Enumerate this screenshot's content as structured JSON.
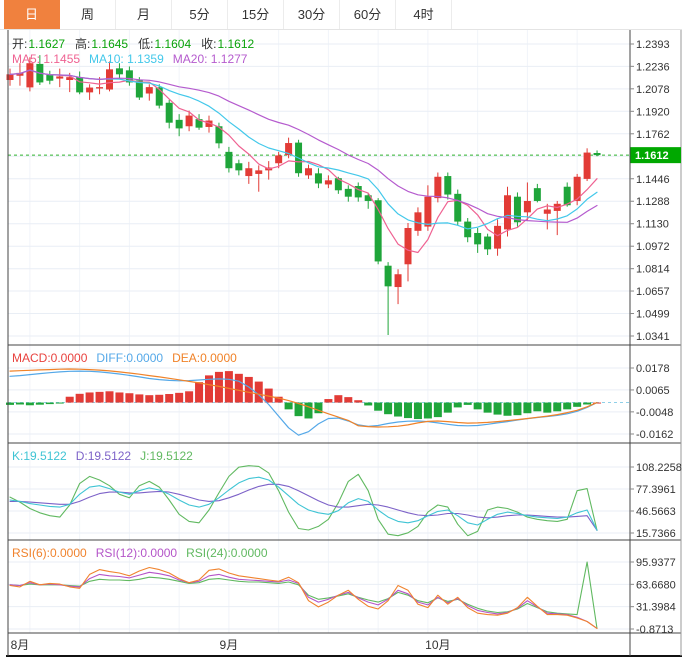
{
  "toolbar": {
    "tabs": [
      {
        "label": "日",
        "active": true
      },
      {
        "label": "周",
        "active": false
      },
      {
        "label": "月",
        "active": false
      },
      {
        "label": "5分",
        "active": false
      },
      {
        "label": "15分",
        "active": false
      },
      {
        "label": "30分",
        "active": false
      },
      {
        "label": "60分",
        "active": false
      },
      {
        "label": "4时",
        "active": false
      }
    ],
    "accent_color": "#f0813e"
  },
  "main_panel": {
    "ohlc_items": [
      {
        "key": "open",
        "label": "开:",
        "value": "1.1627"
      },
      {
        "key": "high",
        "label": "高:",
        "value": "1.1645"
      },
      {
        "key": "low",
        "label": "低:",
        "value": "1.1604"
      },
      {
        "key": "close",
        "label": "收:",
        "value": "1.1612"
      }
    ],
    "ma_legend": [
      {
        "key": "ma5",
        "text": "MA5: 1.1455",
        "color": "#ef6292"
      },
      {
        "key": "ma10",
        "text": "MA10: 1.1359",
        "color": "#43c8ea"
      },
      {
        "key": "ma20",
        "text": "MA20: 1.1277",
        "color": "#b55bce"
      }
    ]
  },
  "macd_panel": {
    "legend": [
      {
        "key": "macd",
        "text": "MACD:0.0000",
        "color": "#e8423e"
      },
      {
        "key": "diff",
        "text": "DIFF:0.0000",
        "color": "#54a8e8"
      },
      {
        "key": "dea",
        "text": "DEA:0.0000",
        "color": "#f08228"
      }
    ]
  },
  "kdj_panel": {
    "legend": [
      {
        "key": "k",
        "text": "K:19.5122",
        "color": "#3fc4d4"
      },
      {
        "key": "d",
        "text": "D:19.5122",
        "color": "#7d62c8"
      },
      {
        "key": "j",
        "text": "J:19.5122",
        "color": "#61b961"
      }
    ]
  },
  "rsi_panel": {
    "legend": [
      {
        "key": "rsi6",
        "text": "RSI(6):0.0000",
        "color": "#f0832e"
      },
      {
        "key": "rsi12",
        "text": "RSI(12):0.0000",
        "color": "#b455c8"
      },
      {
        "key": "rsi24",
        "text": "RSI(24):0.0000",
        "color": "#61b961"
      }
    ]
  },
  "chart_data": {
    "type": "candlestick",
    "timeframe": "daily",
    "x_axis": {
      "month_labels": [
        {
          "text": "8月",
          "index": 1
        },
        {
          "text": "9月",
          "index": 22
        },
        {
          "text": "10月",
          "index": 43
        }
      ]
    },
    "price_axis": {
      "ticks": [
        1.2393,
        1.2236,
        1.2078,
        1.192,
        1.1762,
        1.1446,
        1.1288,
        1.113,
        1.0972,
        1.0814,
        1.0657,
        1.0499,
        1.0341
      ],
      "hidden_tick": 1.1604,
      "current_price": 1.1612,
      "current_price_label": "1.1612"
    },
    "candles_format": [
      "open",
      "high",
      "low",
      "close"
    ],
    "candles": [
      [
        1.214,
        1.222,
        1.21,
        1.218
      ],
      [
        1.217,
        1.2258,
        1.21,
        1.219
      ],
      [
        1.2088,
        1.23,
        1.206,
        1.2258
      ],
      [
        1.2253,
        1.2315,
        1.2105,
        1.2123
      ],
      [
        1.2175,
        1.2205,
        1.211,
        1.2135
      ],
      [
        1.215,
        1.222,
        1.209,
        1.2165
      ],
      [
        1.214,
        1.219,
        1.2055,
        1.216
      ],
      [
        1.216,
        1.22,
        1.204,
        1.2053
      ],
      [
        1.2053,
        1.211,
        1.2,
        1.2087
      ],
      [
        1.209,
        1.216,
        1.204,
        1.209
      ],
      [
        1.2073,
        1.227,
        1.206,
        1.2215
      ],
      [
        1.2222,
        1.2258,
        1.215,
        1.218
      ],
      [
        1.2208,
        1.2235,
        1.21,
        1.2123
      ],
      [
        1.2137,
        1.216,
        1.2,
        1.2017
      ],
      [
        1.2045,
        1.211,
        1.1995,
        1.209
      ],
      [
        1.2088,
        1.211,
        1.194,
        1.196
      ],
      [
        1.198,
        1.2,
        1.18,
        1.184
      ],
      [
        1.186,
        1.19,
        1.1745,
        1.18
      ],
      [
        1.1815,
        1.1925,
        1.178,
        1.189
      ],
      [
        1.1865,
        1.19,
        1.179,
        1.1805
      ],
      [
        1.181,
        1.189,
        1.177,
        1.1855
      ],
      [
        1.1815,
        1.184,
        1.166,
        1.1695
      ],
      [
        1.1635,
        1.167,
        1.149,
        1.152
      ],
      [
        1.1555,
        1.158,
        1.147,
        1.1505
      ],
      [
        1.1465,
        1.1565,
        1.141,
        1.152
      ],
      [
        1.148,
        1.154,
        1.1355,
        1.1505
      ],
      [
        1.1505,
        1.157,
        1.144,
        1.1525
      ],
      [
        1.1555,
        1.1635,
        1.152,
        1.161
      ],
      [
        1.1612,
        1.1735,
        1.159,
        1.1697
      ],
      [
        1.17,
        1.172,
        1.146,
        1.1485
      ],
      [
        1.147,
        1.1545,
        1.1445,
        1.152
      ],
      [
        1.1484,
        1.152,
        1.138,
        1.1413
      ],
      [
        1.1406,
        1.147,
        1.138,
        1.1435
      ],
      [
        1.145,
        1.146,
        1.134,
        1.1365
      ],
      [
        1.1375,
        1.14,
        1.1285,
        1.132
      ],
      [
        1.1395,
        1.142,
        1.1285,
        1.1315
      ],
      [
        1.133,
        1.1345,
        1.1235,
        1.129
      ],
      [
        1.1295,
        1.131,
        1.0845,
        1.0865
      ],
      [
        1.0835,
        1.086,
        1.0348,
        1.069
      ],
      [
        1.0685,
        1.081,
        1.0565,
        1.0775
      ],
      [
        1.0845,
        1.1135,
        1.0725,
        1.11
      ],
      [
        1.108,
        1.1245,
        1.1045,
        1.121
      ],
      [
        1.111,
        1.14,
        1.108,
        1.132
      ],
      [
        1.131,
        1.149,
        1.128,
        1.146
      ],
      [
        1.1465,
        1.149,
        1.13,
        1.1335
      ],
      [
        1.134,
        1.137,
        1.112,
        1.1145
      ],
      [
        1.1145,
        1.117,
        1.1,
        1.1035
      ],
      [
        1.1065,
        1.11,
        1.0925,
        1.0985
      ],
      [
        1.104,
        1.106,
        1.091,
        1.095
      ],
      [
        1.0955,
        1.116,
        1.0905,
        1.1115
      ],
      [
        1.109,
        1.139,
        1.104,
        1.133
      ],
      [
        1.132,
        1.135,
        1.111,
        1.114
      ],
      [
        1.121,
        1.142,
        1.115,
        1.129
      ],
      [
        1.138,
        1.141,
        1.128,
        1.129
      ],
      [
        1.12,
        1.127,
        1.109,
        1.123
      ],
      [
        1.122,
        1.129,
        1.105,
        1.127
      ],
      [
        1.139,
        1.142,
        1.125,
        1.126
      ],
      [
        1.129,
        1.148,
        1.126,
        1.146
      ],
      [
        1.1445,
        1.166,
        1.143,
        1.163
      ],
      [
        1.1627,
        1.1645,
        1.1604,
        1.1612
      ]
    ],
    "ma_periods": [
      5,
      10,
      20
    ],
    "macd": {
      "ticks": [
        0.0178,
        0.0065,
        -0.0048,
        -0.0162
      ],
      "hist": [
        -0.0012,
        -0.001,
        -0.0014,
        -0.0011,
        -0.0008,
        -0.0005,
        0.003,
        0.0045,
        0.0052,
        0.0055,
        0.0058,
        0.0052,
        0.0048,
        0.0042,
        0.0038,
        0.004,
        0.0044,
        0.005,
        0.0058,
        0.0105,
        0.014,
        0.0158,
        0.0162,
        0.0148,
        0.0132,
        0.0108,
        0.0072,
        0.003,
        -0.0035,
        -0.007,
        -0.0082,
        -0.0055,
        0.0018,
        0.0038,
        0.0028,
        0.0012,
        -0.0015,
        -0.0042,
        -0.006,
        -0.0072,
        -0.008,
        -0.0085,
        -0.0082,
        -0.0075,
        -0.0052,
        -0.0025,
        -0.0012,
        -0.0035,
        -0.0052,
        -0.0062,
        -0.0068,
        -0.0065,
        -0.0055,
        -0.0045,
        -0.0052,
        -0.0045,
        -0.0035,
        -0.0022,
        -0.001,
        0.0
      ],
      "diff": [
        0.0135,
        0.0139,
        0.0144,
        0.0149,
        0.0154,
        0.0158,
        0.0161,
        0.0162,
        0.0161,
        0.0158,
        0.0153,
        0.0147,
        0.014,
        0.0132,
        0.0124,
        0.0118,
        0.0114,
        0.0112,
        0.0113,
        0.0116,
        0.012,
        0.0122,
        0.012,
        0.011,
        0.008,
        0.004,
        -0.001,
        -0.007,
        -0.013,
        -0.0168,
        -0.015,
        -0.011,
        -0.0082,
        -0.008,
        -0.0095,
        -0.0115,
        -0.0123,
        -0.0118,
        -0.0108,
        -0.01,
        -0.0096,
        -0.0095,
        -0.0098,
        -0.0105,
        -0.0112,
        -0.0118,
        -0.012,
        -0.0118,
        -0.0112,
        -0.0105,
        -0.0098,
        -0.009,
        -0.0083,
        -0.0077,
        -0.0072,
        -0.0066,
        -0.0058,
        -0.0045,
        -0.0025,
        0.0
      ],
      "dea": [
        0.0162,
        0.0164,
        0.0166,
        0.0168,
        0.017,
        0.0172,
        0.0173,
        0.0172,
        0.017,
        0.0167,
        0.0163,
        0.0158,
        0.0152,
        0.0146,
        0.0139,
        0.0132,
        0.0125,
        0.0117,
        0.0109,
        0.0101,
        0.0092,
        0.0083,
        0.0073,
        0.0063,
        0.0053,
        0.0043,
        0.0033,
        0.0023,
        0.001,
        -0.0005,
        -0.0022,
        -0.004,
        -0.0058,
        -0.0075,
        -0.0092,
        -0.012,
        -0.0124,
        -0.0126,
        -0.0125,
        -0.0122,
        -0.0115,
        -0.0105,
        -0.0097,
        -0.0095,
        -0.0098,
        -0.0103,
        -0.0106,
        -0.0105,
        -0.0102,
        -0.0098,
        -0.0093,
        -0.0088,
        -0.0082,
        -0.0076,
        -0.007,
        -0.0062,
        -0.0052,
        -0.004,
        -0.0022,
        0.0
      ]
    },
    "kdj": {
      "ticks": [
        108.2258,
        77.3961,
        46.5663,
        15.7366
      ],
      "k": [
        62,
        60,
        57,
        55,
        53,
        52,
        56,
        70,
        80,
        82,
        78,
        73,
        70,
        75,
        79,
        76,
        70,
        62,
        55,
        52,
        56,
        65,
        76,
        86,
        92,
        94,
        90,
        80,
        68,
        56,
        48,
        44,
        42,
        47,
        58,
        64,
        60,
        48,
        38,
        32,
        30,
        33,
        40,
        46,
        48,
        40,
        30,
        27,
        35,
        42,
        45,
        43,
        40,
        38,
        37,
        36,
        38,
        44,
        48,
        19.51
      ],
      "d": [
        60,
        60,
        59,
        58,
        57,
        56,
        56,
        60,
        66,
        71,
        73,
        73,
        72,
        72,
        73,
        74,
        73,
        70,
        66,
        62,
        60,
        61,
        65,
        70,
        76,
        81,
        84,
        84,
        81,
        75,
        68,
        61,
        55,
        52,
        52,
        54,
        56,
        55,
        52,
        48,
        44,
        41,
        40,
        41,
        43,
        43,
        41,
        38,
        37,
        38,
        40,
        41,
        41,
        40,
        39,
        38,
        38,
        39,
        40,
        19.51
      ],
      "j": [
        66,
        59,
        50,
        44,
        40,
        38,
        55,
        85,
        95,
        90,
        82,
        70,
        65,
        82,
        88,
        80,
        62,
        42,
        32,
        30,
        48,
        72,
        95,
        108,
        110,
        109,
        100,
        75,
        45,
        22,
        20,
        25,
        35,
        58,
        88,
        98,
        75,
        35,
        14,
        12,
        16,
        25,
        45,
        55,
        52,
        28,
        12,
        18,
        48,
        52,
        50,
        45,
        38,
        35,
        33,
        32,
        35,
        75,
        78,
        19.51
      ]
    },
    "rsi": {
      "ticks": [
        95.9377,
        63.668,
        31.3984,
        -0.8713
      ],
      "rsi6": [
        62,
        60,
        68,
        63,
        65,
        64,
        60,
        58,
        78,
        85,
        82,
        80,
        76,
        83,
        88,
        85,
        80,
        72,
        66,
        70,
        84,
        86,
        80,
        76,
        74,
        72,
        70,
        68,
        74,
        66,
        40,
        31,
        38,
        48,
        55,
        42,
        32,
        28,
        40,
        62,
        55,
        35,
        30,
        48,
        35,
        45,
        30,
        22,
        20,
        19,
        22,
        30,
        45,
        32,
        20,
        20,
        19,
        15,
        10,
        0
      ],
      "rsi12": [
        63,
        62,
        66,
        63,
        64,
        63,
        61,
        60,
        72,
        78,
        76,
        75,
        73,
        77,
        81,
        79,
        76,
        70,
        66,
        68,
        76,
        78,
        74,
        71,
        70,
        69,
        68,
        67,
        70,
        65,
        45,
        38,
        42,
        48,
        52,
        44,
        38,
        34,
        42,
        55,
        50,
        38,
        34,
        45,
        37,
        43,
        33,
        26,
        23,
        21,
        23,
        29,
        40,
        31,
        22,
        21,
        20,
        16,
        10,
        0
      ],
      "rsi24": [
        63,
        62,
        64,
        63,
        63,
        63,
        62,
        61,
        68,
        71,
        70,
        70,
        69,
        71,
        74,
        73,
        71,
        68,
        65,
        66,
        71,
        72,
        70,
        68,
        67,
        67,
        66,
        65,
        67,
        63,
        48,
        42,
        44,
        47,
        50,
        45,
        41,
        38,
        43,
        52,
        48,
        40,
        37,
        44,
        39,
        42,
        35,
        29,
        25,
        23,
        24,
        28,
        36,
        30,
        24,
        22,
        21,
        20,
        96,
        0
      ]
    },
    "colors": {
      "up": "#e23b36",
      "down": "#1fa53a",
      "ma5": "#ef6292",
      "ma10": "#43c8ea",
      "ma20": "#b55bce",
      "diff": "#54a8e8",
      "dea": "#f08228",
      "k": "#3fc4d4",
      "d": "#7d62c8",
      "j": "#61b961",
      "rsi6": "#f0832e",
      "rsi12": "#b455c8",
      "rsi24": "#61b961",
      "price_tag_bg": "#00a800",
      "price_tag_text": "#ffffff",
      "dotted_line": "#2fb32f",
      "grid": "#e9eef5",
      "vgrid": "#f1f4f9",
      "separator": "#444444",
      "axis_text": "#333333",
      "macd_zero_line": "#8fd0e8"
    }
  }
}
